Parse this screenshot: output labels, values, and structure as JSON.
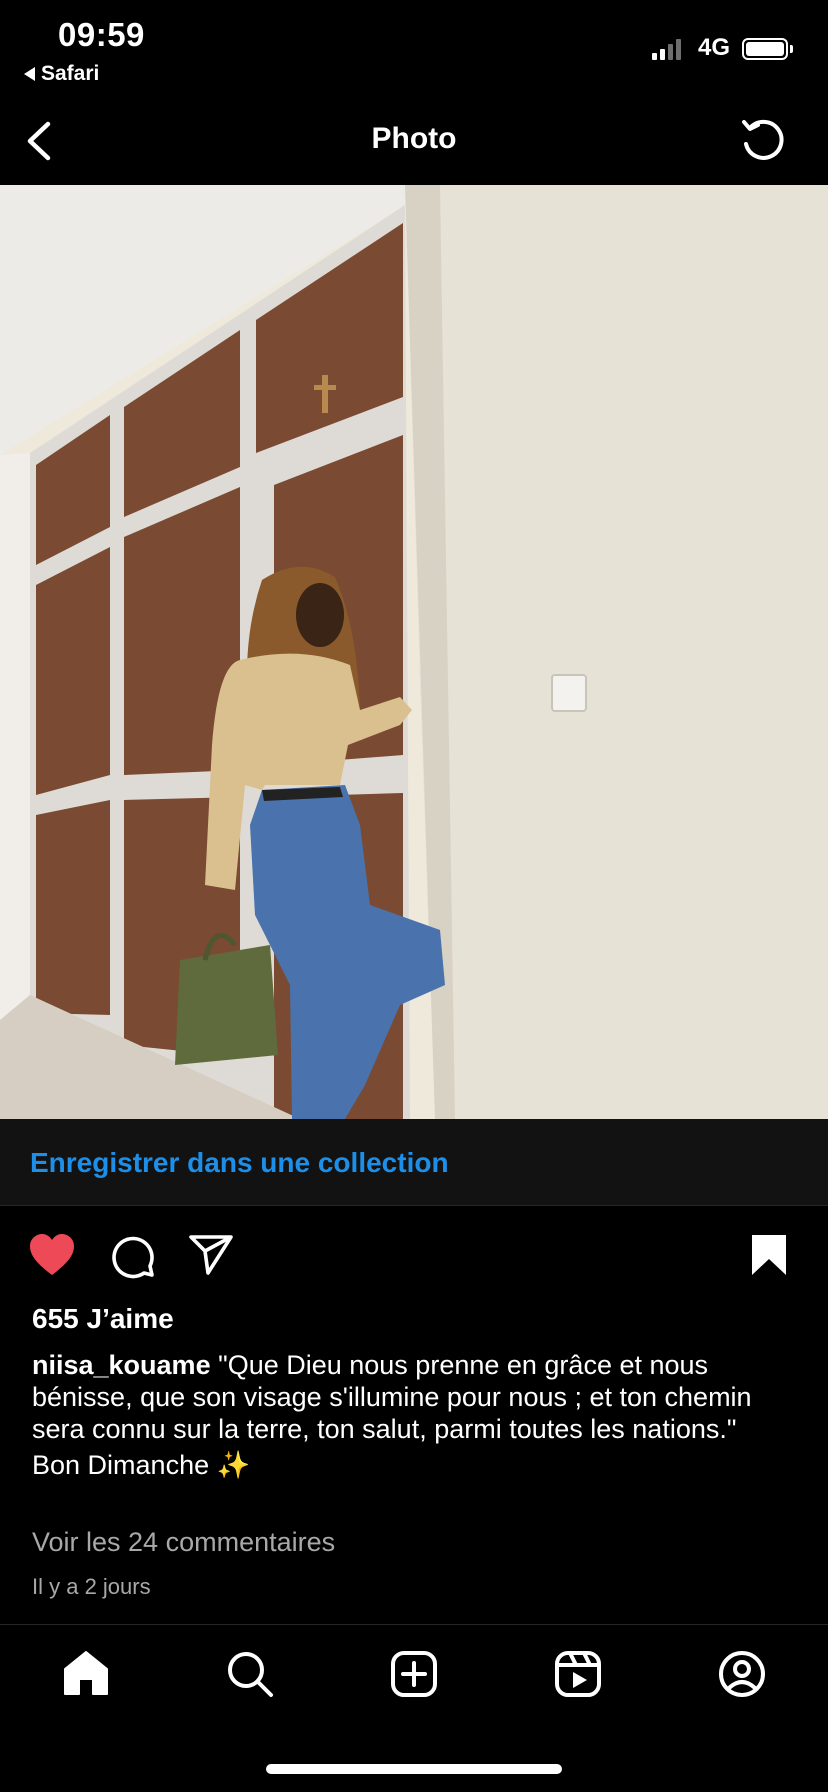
{
  "status_bar": {
    "time": "09:59",
    "back_app": "Safari",
    "network": "4G"
  },
  "header": {
    "title": "Photo"
  },
  "save_collection": {
    "label": "Enregistrer dans une collection"
  },
  "post": {
    "likes": "655 J’aime",
    "username": "niisa_kouame",
    "caption_text": "\"Que Dieu nous prenne en grâce et nous bénisse, que son visage s'illumine pour nous ; et ton chemin sera connu sur la terre, ton salut, parmi toutes les nations.\"",
    "caption_line2": "Bon Dimanche ✨",
    "view_comments": "Voir les 24 commentaires",
    "time_ago": "Il y a 2 jours",
    "liked": true,
    "saved": true
  },
  "tab_bar": {
    "items": [
      "home-icon",
      "search-icon",
      "new-post-icon",
      "reels-icon",
      "profile-icon"
    ]
  },
  "colors": {
    "like_red": "#ed4956",
    "link_blue": "#1d8fe8",
    "muted_text": "#a8a8a8"
  }
}
